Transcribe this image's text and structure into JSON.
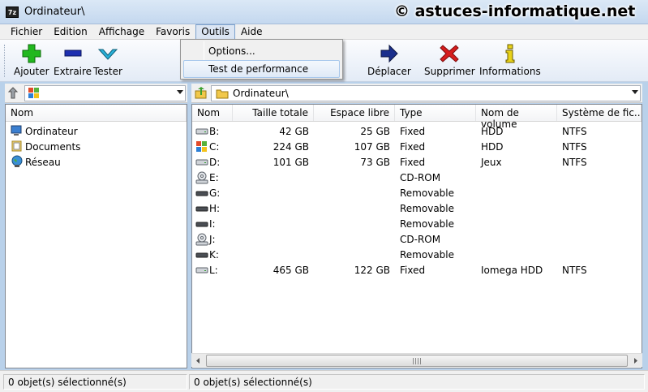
{
  "window": {
    "title": "Ordinateur\\",
    "app_icon": "7z"
  },
  "watermark": "© astuces-informatique.net",
  "menu": [
    "Fichier",
    "Edition",
    "Affichage",
    "Favoris",
    "Outils",
    "Aide"
  ],
  "dropdown": {
    "items": [
      "Options...",
      "Test de performance"
    ]
  },
  "toolbar": {
    "add": "Ajouter",
    "extract": "Extraire",
    "test": "Tester",
    "move": "Déplacer",
    "delete": "Supprimer",
    "info": "Informations"
  },
  "left_pane": {
    "column": "Nom",
    "items": [
      "Ordinateur",
      "Documents",
      "Réseau"
    ],
    "status": "0 objet(s) sélectionné(s)"
  },
  "right_pane": {
    "address": "Ordinateur\\",
    "columns": [
      "Nom",
      "Taille totale",
      "Espace libre",
      "Type",
      "Nom de volume",
      "Système de fic..."
    ],
    "rows": [
      {
        "name": "B:",
        "total": "42 GB",
        "free": "25 GB",
        "type": "Fixed",
        "volume": "HDD",
        "fs": "NTFS",
        "icon": "hdd-icon"
      },
      {
        "name": "C:",
        "total": "224 GB",
        "free": "107 GB",
        "type": "Fixed",
        "volume": "HDD",
        "fs": "NTFS",
        "icon": "windows-drive-icon"
      },
      {
        "name": "D:",
        "total": "101 GB",
        "free": "73 GB",
        "type": "Fixed",
        "volume": "Jeux",
        "fs": "NTFS",
        "icon": "hdd-icon"
      },
      {
        "name": "E:",
        "total": "",
        "free": "",
        "type": "CD-ROM",
        "volume": "",
        "fs": "",
        "icon": "cdrom-icon"
      },
      {
        "name": "G:",
        "total": "",
        "free": "",
        "type": "Removable",
        "volume": "",
        "fs": "",
        "icon": "removable-icon"
      },
      {
        "name": "H:",
        "total": "",
        "free": "",
        "type": "Removable",
        "volume": "",
        "fs": "",
        "icon": "removable-icon"
      },
      {
        "name": "I:",
        "total": "",
        "free": "",
        "type": "Removable",
        "volume": "",
        "fs": "",
        "icon": "removable-icon"
      },
      {
        "name": "J:",
        "total": "",
        "free": "",
        "type": "CD-ROM",
        "volume": "",
        "fs": "",
        "icon": "cdrom-icon"
      },
      {
        "name": "K:",
        "total": "",
        "free": "",
        "type": "Removable",
        "volume": "",
        "fs": "",
        "icon": "removable-icon"
      },
      {
        "name": "L:",
        "total": "465 GB",
        "free": "122 GB",
        "type": "Fixed",
        "volume": "Iomega HDD",
        "fs": "NTFS",
        "icon": "hdd-icon"
      }
    ],
    "status": "0 objet(s) sélectionné(s)"
  },
  "colors": {
    "add": "#22b81e",
    "extract": "#1d2fb0",
    "test": "#27b0d8",
    "move": "#1a2f8c",
    "delete": "#d61d1d",
    "info": "#e8d21a"
  }
}
